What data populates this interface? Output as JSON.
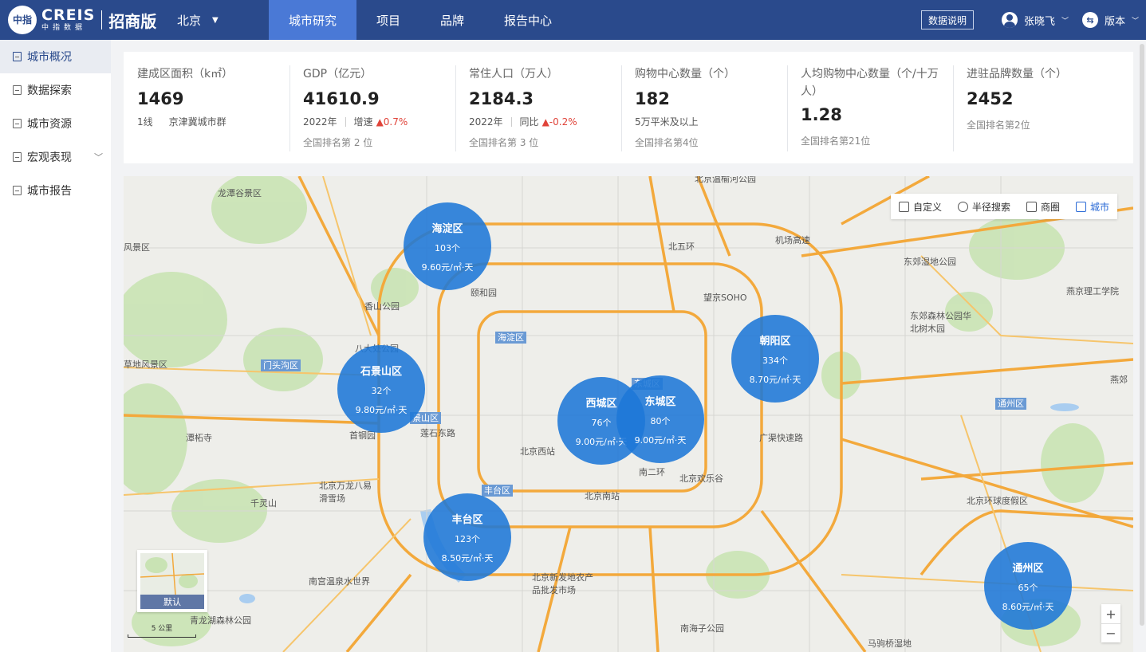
{
  "header": {
    "logo_mark": "中指",
    "brand": "CREIS",
    "brand_sub": "中指数据",
    "edition": "招商版",
    "city": "北京",
    "nav": [
      {
        "label": "城市研究",
        "active": true
      },
      {
        "label": "项目",
        "active": false
      },
      {
        "label": "品牌",
        "active": false
      },
      {
        "label": "报告中心",
        "active": false
      }
    ],
    "doc_button": "数据说明",
    "user_name": "张晓飞",
    "version_label": "版本",
    "accent_color": "#2a4a8c",
    "active_nav_color": "#4a79d6"
  },
  "sidebar": {
    "items": [
      {
        "label": "城市概况",
        "active": true
      },
      {
        "label": "数据探索",
        "active": false
      },
      {
        "label": "城市资源",
        "active": false
      },
      {
        "label": "宏观表现",
        "active": false,
        "expandable": true
      },
      {
        "label": "城市报告",
        "active": false
      }
    ]
  },
  "stats": {
    "area": {
      "label": "建成区面积（k㎡）",
      "value": "1469",
      "tier": "1线",
      "region": "京津冀城市群"
    },
    "gdp": {
      "label": "GDP（亿元）",
      "value": "41610.9",
      "year": "2022年",
      "growth_label": "增速",
      "growth": "▲0.7%",
      "rank": "全国排名第 2 位"
    },
    "population": {
      "label": "常住人口（万人）",
      "value": "2184.3",
      "year": "2022年",
      "growth_label": "同比",
      "growth": "▲-0.2%",
      "rank": "全国排名第 3 位"
    },
    "malls": {
      "label": "购物中心数量（个）",
      "value": "182",
      "note": "5万平米及以上",
      "rank": "全国排名第4位"
    },
    "malls_per_capita": {
      "label": "人均购物中心数量（个/十万人）",
      "value": "1.28",
      "rank": "全国排名第21位"
    },
    "brands": {
      "label": "进驻品牌数量（个）",
      "value": "2452",
      "rank": "全国排名第2位"
    }
  },
  "map": {
    "toolbar": [
      {
        "label": "自定义",
        "icon": "edit-square-icon",
        "active": false
      },
      {
        "label": "半径搜索",
        "icon": "radius-icon",
        "active": false
      },
      {
        "label": "商圈",
        "icon": "shop-icon",
        "active": false
      },
      {
        "label": "城市",
        "icon": "city-icon",
        "active": true
      }
    ],
    "districts": [
      {
        "name": "海淀区",
        "count": "103个",
        "price": "9.60元/㎡·天"
      },
      {
        "name": "石景山区",
        "count": "32个",
        "price": "9.80元/㎡·天"
      },
      {
        "name": "西城区",
        "count": "76个",
        "price": "9.00元/㎡·天"
      },
      {
        "name": "东城区",
        "count": "80个",
        "price": "9.00元/㎡·天"
      },
      {
        "name": "朝阳区",
        "count": "334个",
        "price": "8.70元/㎡·天"
      },
      {
        "name": "丰台区",
        "count": "123个",
        "price": "8.50元/㎡·天"
      },
      {
        "name": "通州区",
        "count": "65个",
        "price": "8.60元/㎡·天"
      }
    ],
    "district_tags": [
      "门头沟区",
      "海淀区",
      "景山区",
      "丰台区",
      "通州区",
      "东城区"
    ],
    "places": [
      "龙潭谷景区",
      "风景区",
      "颐和园",
      "香山公园",
      "八大处公园",
      "草地风景区",
      "潭柘寺",
      "首钢园",
      "莲石东路",
      "北京西站",
      "北京万龙八易滑雪场",
      "千灵山",
      "北京南站",
      "南二环",
      "北京欢乐谷",
      "广渠快速路",
      "北五环",
      "机场高速",
      "望京SOHO",
      "东郊湿地公园",
      "东郊森林公园华北树木园",
      "燕京理工学院",
      "北京环球度假区",
      "南宫温泉水世界",
      "北京新发地农产品批发市场",
      "青龙湖森林公园",
      "南海子公园",
      "马驹桥湿地",
      "燕郊",
      "北京温榆河公园"
    ],
    "minimap_label": "默认",
    "scale_label": "5 公里",
    "bubble_color": "#1e78d7"
  }
}
